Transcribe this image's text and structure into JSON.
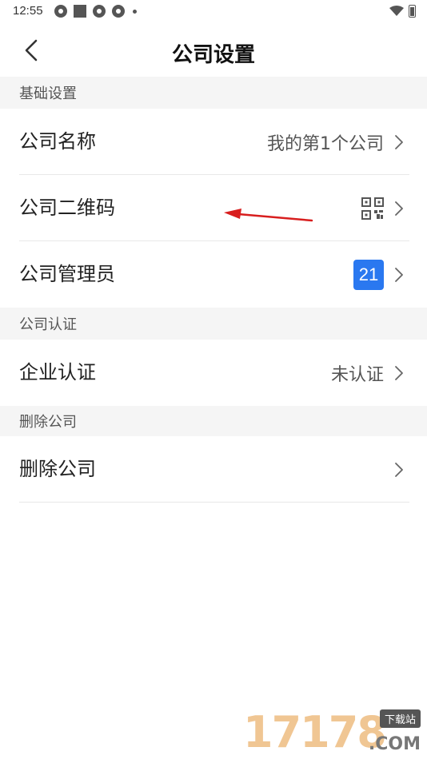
{
  "status_bar": {
    "time": "12:55"
  },
  "header": {
    "title": "公司设置"
  },
  "sections": {
    "basic": {
      "label": "基础设置",
      "company_name": {
        "label": "公司名称",
        "value": "我的第1个公司"
      },
      "company_qrcode": {
        "label": "公司二维码"
      },
      "company_admins": {
        "label": "公司管理员",
        "badge": "21"
      }
    },
    "certification": {
      "label": "公司认证",
      "enterprise_cert": {
        "label": "企业认证",
        "value": "未认证"
      }
    },
    "delete": {
      "label": "删除公司",
      "delete_company": {
        "label": "删除公司"
      }
    }
  },
  "watermark": {
    "number": "17178",
    "tag": "下载站",
    "suffix": ".COM"
  },
  "colors": {
    "accent": "#2a78f0",
    "section_bg": "#f5f5f5",
    "annotation_arrow": "#d81e1e"
  }
}
